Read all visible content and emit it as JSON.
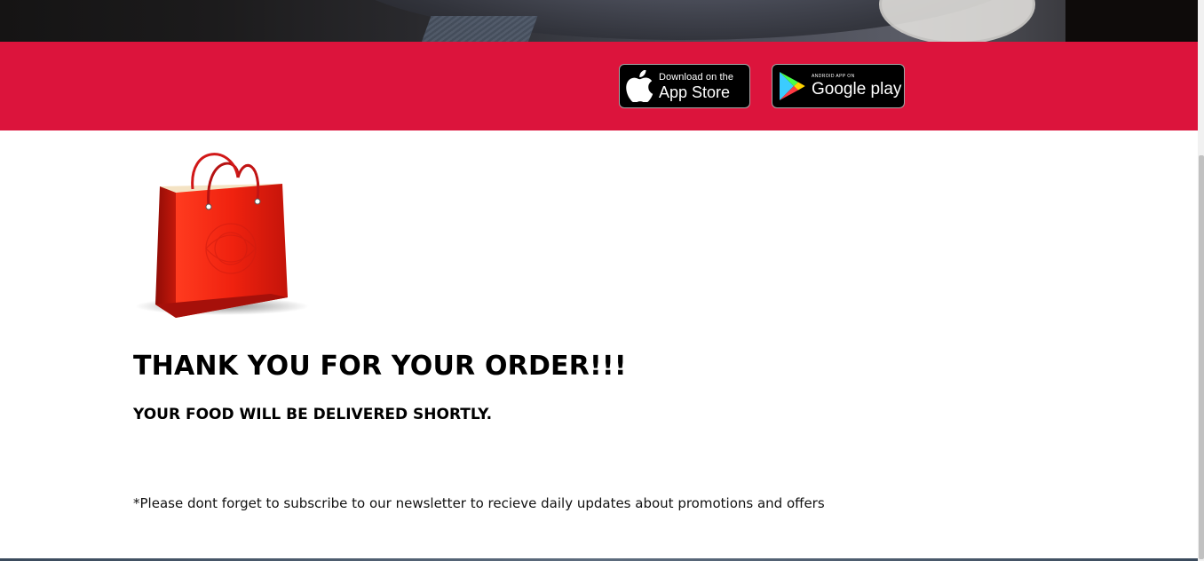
{
  "app_bar": {
    "app_store": {
      "small_text": "Download on the",
      "large_text": "App Store"
    },
    "google_play": {
      "small_text": "ANDROID APP ON",
      "large_text": "Google play"
    },
    "background_color": "#dc143c"
  },
  "content": {
    "image": "shopping-bag",
    "title": "THANK YOU FOR YOUR ORDER!!!",
    "subtitle": "YOUR FOOD WILL BE DELIVERED SHORTLY.",
    "newsletter_note": "*Please dont forget to subscribe to our newsletter to recieve daily updates about promotions and offers"
  },
  "colors": {
    "accent": "#dc143c",
    "text": "#000000",
    "bag_red": "#e31a12"
  }
}
